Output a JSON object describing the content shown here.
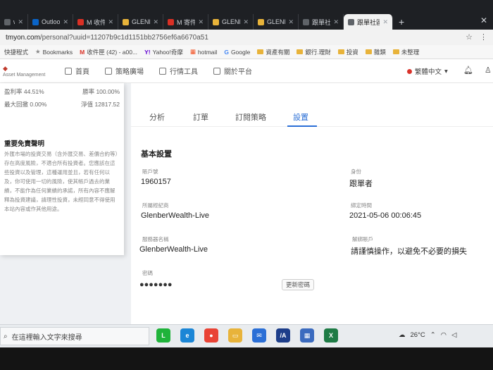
{
  "browser": {
    "tabs": [
      {
        "label": "www.c",
        "color": "#5f6368",
        "active": false
      },
      {
        "label": "Outlook",
        "color": "#0a64c8",
        "active": false
      },
      {
        "label": "M 收件匣",
        "color": "#d93025",
        "active": false
      },
      {
        "label": "GLENB",
        "color": "#e8b33a",
        "active": false
      },
      {
        "label": "M 寄件備份",
        "color": "#d93025",
        "active": false
      },
      {
        "label": "GLENB",
        "color": "#e8b33a",
        "active": false
      },
      {
        "label": "GLENB",
        "color": "#e8b33a",
        "active": false
      },
      {
        "label": "跟單社區",
        "color": "#5f6368",
        "active": false
      },
      {
        "label": "跟單社區",
        "color": "#5f6368",
        "active": true
      }
    ],
    "new_tab": "+",
    "url_host": "tmyon.com",
    "url_path": "/personal?uuid=11207b9c1d1151bb2756ef6a6670a51",
    "bookmarks": [
      {
        "label": "快捷程式",
        "type": "text"
      },
      {
        "label": "Bookmarks",
        "type": "star"
      },
      {
        "label": "收件匣 (42) - a00...",
        "type": "gmail"
      },
      {
        "label": "Yahoo!奇摩",
        "type": "yahoo"
      },
      {
        "label": "hotmail",
        "type": "ms"
      },
      {
        "label": "Google",
        "type": "google"
      },
      {
        "label": "資產有關",
        "type": "folder"
      },
      {
        "label": "銀行.理財",
        "type": "folder"
      },
      {
        "label": "投資",
        "type": "folder"
      },
      {
        "label": "雜類",
        "type": "folder"
      },
      {
        "label": "未整理",
        "type": "folder"
      }
    ]
  },
  "site": {
    "logo_text": "Asset Management",
    "nav": [
      {
        "label": "首頁",
        "icon": "home-icon"
      },
      {
        "label": "策略廣場",
        "icon": "grid-icon"
      },
      {
        "label": "行情工具",
        "icon": "chart-icon"
      },
      {
        "label": "關於平台",
        "icon": "info-icon"
      }
    ],
    "language": "繁體中文"
  },
  "left": {
    "stats": [
      {
        "left": "盈利率 44.51%",
        "right": "勝率 100.00%"
      },
      {
        "left": "最大回撤 0.00%",
        "right": "淨值 12817.52"
      }
    ],
    "disclaimer_title": "重要免責聲明",
    "disclaimer_text": "外匯市場的投資交易（含外匯交易、差價合約等）存在高度風險，不適合所有投資者。您應該在這些投資以及管理，這種運用並且，若有任何以及，你可使用一切的風險，使其帳戶過去的業績，不能作為任何業績的承諾，所有內容不應解釋為投資建議，請理性投資，未經同意不得使用本站內容或作其他用途。"
  },
  "card": {
    "tabs": [
      "分析",
      "訂單",
      "訂閱策略",
      "設置"
    ],
    "active_tab": 3,
    "section_title": "基本設置",
    "fields": [
      {
        "label": "賬戶號",
        "value": "1960157"
      },
      {
        "label": "身份",
        "value": "跟單者"
      },
      {
        "label": "所屬經紀商",
        "value": "GlenberWealth-Live"
      },
      {
        "label": "綁定時間",
        "value": "2021-05-06 00:06:45"
      },
      {
        "label": "服務器名稱",
        "value": "GlenberWealth-Live"
      },
      {
        "label": "解綁賬戶",
        "value": "請謹慎操作，以避免不必要的損失"
      }
    ],
    "password_label": "密碼",
    "password_mask": "●●●●●●●",
    "change_password": "更新密碼"
  },
  "taskbar": {
    "search_placeholder": "在這裡輸入文字來搜尋",
    "weather": "26°C",
    "apps": [
      {
        "name": "line-app-icon",
        "color": "#1fb33a",
        "glyph": "L"
      },
      {
        "name": "edge-app-icon",
        "color": "#1b86d6",
        "glyph": "e"
      },
      {
        "name": "chrome-app-icon",
        "color": "#e94335",
        "glyph": "●"
      },
      {
        "name": "file-explorer-icon",
        "color": "#e8b33a",
        "glyph": "▭"
      },
      {
        "name": "mail-app-icon",
        "color": "#2b6fd6",
        "glyph": "✉"
      },
      {
        "name": "mt4-app-icon",
        "color": "#1d3e8a",
        "glyph": "/A"
      },
      {
        "name": "terminal-app-icon",
        "color": "#3b6bbf",
        "glyph": "▦"
      },
      {
        "name": "excel-app-icon",
        "color": "#1e7b45",
        "glyph": "X"
      }
    ]
  }
}
